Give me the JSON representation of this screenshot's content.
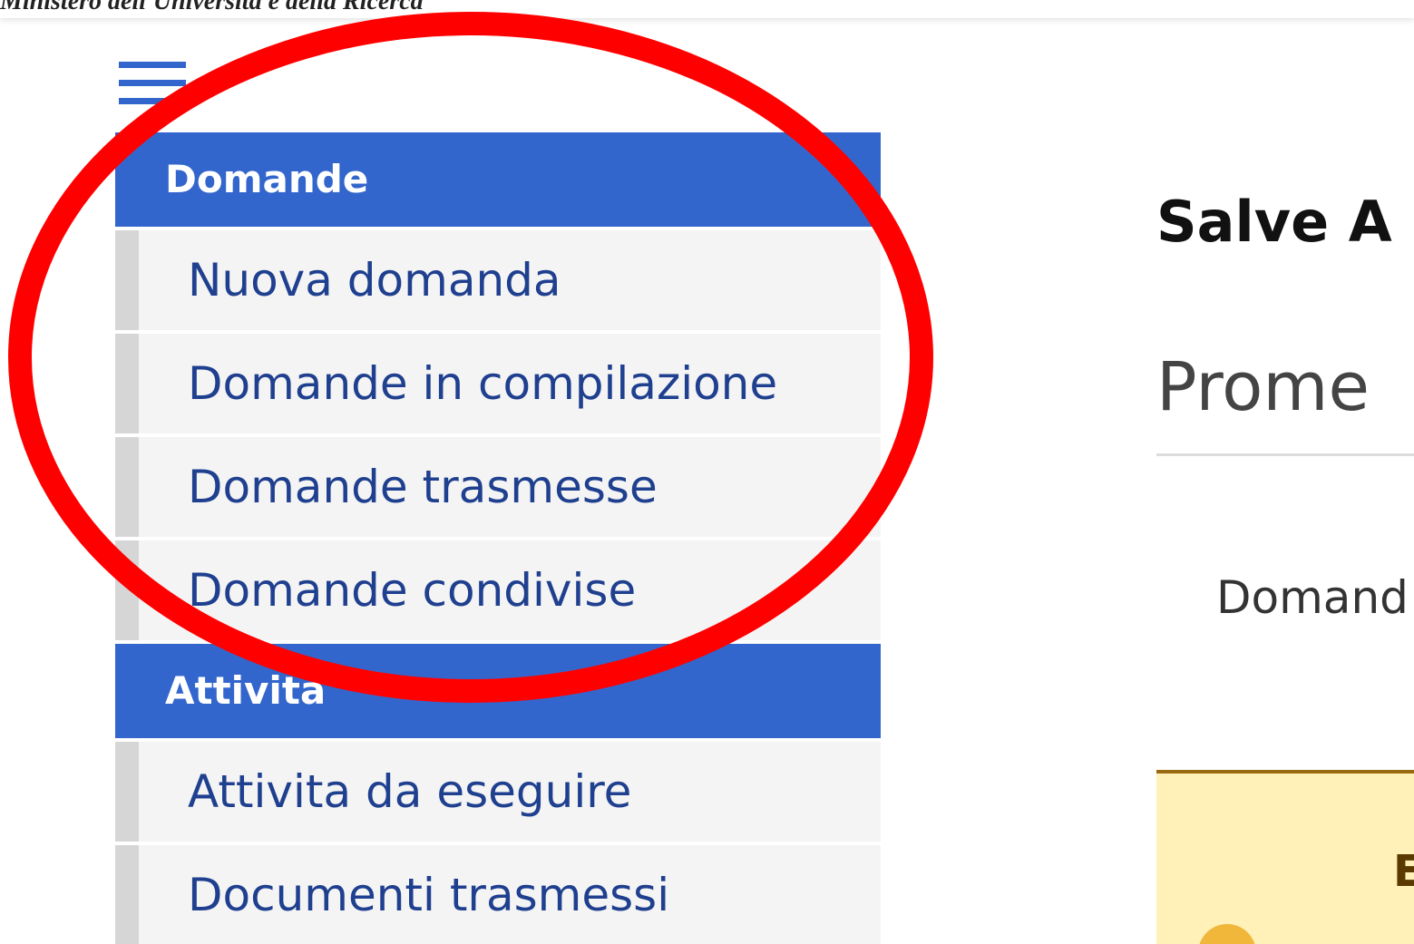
{
  "header": {
    "ministry_text": "Ministero dell'Universita e della Ricerca"
  },
  "sidebar": {
    "menu_icon": "hamburger-menu-icon",
    "sections": [
      {
        "title": "Domande",
        "items": [
          "Nuova domanda",
          "Domande in compilazione",
          "Domande trasmesse",
          "Domande condivise"
        ]
      },
      {
        "title": "Attivita",
        "items": [
          "Attivita da eseguire",
          "Documenti trasmessi"
        ]
      }
    ]
  },
  "main": {
    "greeting": "Salve A",
    "subtitle": "Prome",
    "menu_link": "Domand",
    "alert_title": "E"
  },
  "colors": {
    "accent": "#3366cc",
    "annotation": "#ff0000",
    "alert_bg": "#fff1b8",
    "alert_border": "#9a6a10"
  }
}
